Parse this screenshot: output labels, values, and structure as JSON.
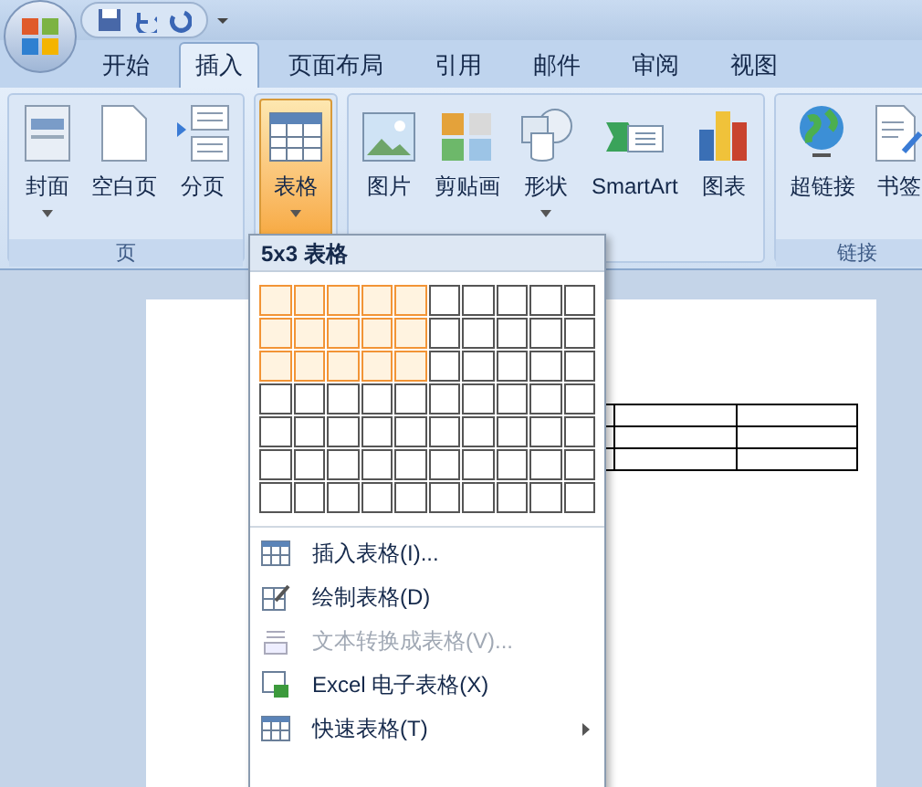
{
  "tabs": [
    {
      "label": "开始",
      "selected": false
    },
    {
      "label": "插入",
      "selected": true
    },
    {
      "label": "页面布局",
      "selected": false
    },
    {
      "label": "引用",
      "selected": false
    },
    {
      "label": "邮件",
      "selected": false
    },
    {
      "label": "审阅",
      "selected": false
    },
    {
      "label": "视图",
      "selected": false
    }
  ],
  "ribbon_groups": [
    {
      "label": "页",
      "buttons": [
        {
          "label": "封面",
          "kind": "cover",
          "dropdown": true,
          "selected": false
        },
        {
          "label": "空白页",
          "kind": "page",
          "dropdown": false,
          "selected": false
        },
        {
          "label": "分页",
          "kind": "break",
          "dropdown": false,
          "selected": false
        }
      ]
    },
    {
      "buttons": [
        {
          "label": "表格",
          "kind": "table",
          "dropdown": true,
          "selected": true
        }
      ]
    },
    {
      "buttons": [
        {
          "label": "图片",
          "kind": "picture",
          "dropdown": false,
          "selected": false
        },
        {
          "label": "剪贴画",
          "kind": "clipart",
          "dropdown": false,
          "selected": false
        },
        {
          "label": "形状",
          "kind": "shapes",
          "dropdown": true,
          "selected": false
        },
        {
          "label": "SmartArt",
          "kind": "smartart",
          "dropdown": false,
          "selected": false
        },
        {
          "label": "图表",
          "kind": "chart",
          "dropdown": false,
          "selected": false
        }
      ]
    },
    {
      "label": "链接",
      "buttons": [
        {
          "label": "超链接",
          "kind": "globe",
          "dropdown": false,
          "selected": false
        },
        {
          "label": "书签",
          "kind": "bookmark",
          "dropdown": false,
          "selected": false
        }
      ]
    }
  ],
  "table_menu": {
    "header": "5x3 表格",
    "grid": [
      {
        "cells": [
          {
            "selected": true
          },
          {
            "selected": true
          },
          {
            "selected": true
          },
          {
            "selected": true
          },
          {
            "selected": true
          },
          {
            "selected": false
          },
          {
            "selected": false
          },
          {
            "selected": false
          },
          {
            "selected": false
          },
          {
            "selected": false
          }
        ]
      },
      {
        "cells": [
          {
            "selected": true
          },
          {
            "selected": true
          },
          {
            "selected": true
          },
          {
            "selected": true
          },
          {
            "selected": true
          },
          {
            "selected": false
          },
          {
            "selected": false
          },
          {
            "selected": false
          },
          {
            "selected": false
          },
          {
            "selected": false
          }
        ]
      },
      {
        "cells": [
          {
            "selected": true
          },
          {
            "selected": true
          },
          {
            "selected": true
          },
          {
            "selected": true
          },
          {
            "selected": true
          },
          {
            "selected": false
          },
          {
            "selected": false
          },
          {
            "selected": false
          },
          {
            "selected": false
          },
          {
            "selected": false
          }
        ]
      },
      {
        "cells": [
          {
            "selected": false
          },
          {
            "selected": false
          },
          {
            "selected": false
          },
          {
            "selected": false
          },
          {
            "selected": false
          },
          {
            "selected": false
          },
          {
            "selected": false
          },
          {
            "selected": false
          },
          {
            "selected": false
          },
          {
            "selected": false
          }
        ]
      },
      {
        "cells": [
          {
            "selected": false
          },
          {
            "selected": false
          },
          {
            "selected": false
          },
          {
            "selected": false
          },
          {
            "selected": false
          },
          {
            "selected": false
          },
          {
            "selected": false
          },
          {
            "selected": false
          },
          {
            "selected": false
          },
          {
            "selected": false
          }
        ]
      },
      {
        "cells": [
          {
            "selected": false
          },
          {
            "selected": false
          },
          {
            "selected": false
          },
          {
            "selected": false
          },
          {
            "selected": false
          },
          {
            "selected": false
          },
          {
            "selected": false
          },
          {
            "selected": false
          },
          {
            "selected": false
          },
          {
            "selected": false
          }
        ]
      },
      {
        "cells": [
          {
            "selected": false
          },
          {
            "selected": false
          },
          {
            "selected": false
          },
          {
            "selected": false
          },
          {
            "selected": false
          },
          {
            "selected": false
          },
          {
            "selected": false
          },
          {
            "selected": false
          },
          {
            "selected": false
          },
          {
            "selected": false
          }
        ]
      }
    ],
    "items": [
      {
        "label": "插入表格(I)...",
        "kind": "table",
        "disabled": false,
        "submenu": false
      },
      {
        "label": "绘制表格(D)",
        "kind": "draw",
        "disabled": false,
        "submenu": false
      },
      {
        "label": "文本转换成表格(V)...",
        "kind": "convert",
        "disabled": true,
        "submenu": false
      },
      {
        "label": "Excel 电子表格(X)",
        "kind": "excel",
        "disabled": false,
        "submenu": false
      },
      {
        "label": "快速表格(T)",
        "kind": "table",
        "disabled": false,
        "submenu": true
      }
    ]
  }
}
